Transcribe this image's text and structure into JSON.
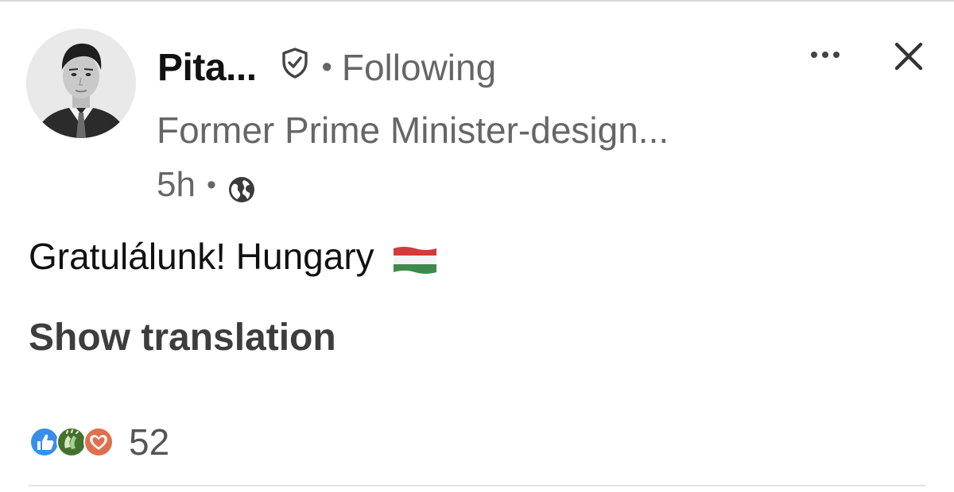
{
  "post": {
    "author": {
      "name": "Pita...",
      "follow_status": "Following",
      "separator": "•",
      "headline": "Former Prime Minister-design..."
    },
    "meta": {
      "timestamp": "5h",
      "separator": "•",
      "visibility_icon": "globe-icon"
    },
    "content": {
      "text": "Gratulálunk! Hungary",
      "flag_icon": "hungary-flag-icon"
    },
    "translation_link": "Show translation",
    "reactions": {
      "icons": [
        "like-icon",
        "celebrate-icon",
        "love-icon"
      ],
      "count": "52"
    },
    "controls": {
      "more_icon": "more-options-icon",
      "close_icon": "close-icon"
    }
  },
  "colors": {
    "primary_text": "#111111",
    "secondary_text": "#666666",
    "link_text": "#3d3d3d",
    "like_blue": "#378fe9",
    "celebrate_green": "#44712e",
    "love_orange": "#df704d"
  }
}
